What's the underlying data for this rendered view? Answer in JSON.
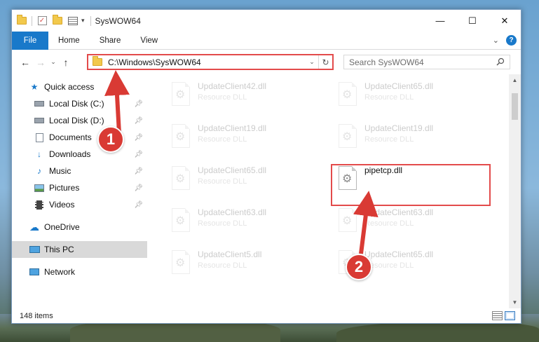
{
  "window": {
    "title": "SysWOW64"
  },
  "ribbon": {
    "tabs": [
      "File",
      "Home",
      "Share",
      "View"
    ]
  },
  "address": {
    "path": "C:\\Windows\\SysWOW64",
    "search_placeholder": "Search SysWOW64"
  },
  "nav": {
    "items": [
      {
        "label": "Quick access",
        "icon": "star-icon"
      },
      {
        "label": "Local Disk (C:)",
        "icon": "drive-icon"
      },
      {
        "label": "Local Disk (D:)",
        "icon": "drive-icon"
      },
      {
        "label": "Documents",
        "icon": "documents-icon"
      },
      {
        "label": "Downloads",
        "icon": "download-icon"
      },
      {
        "label": "Music",
        "icon": "music-icon"
      },
      {
        "label": "Pictures",
        "icon": "pictures-icon"
      },
      {
        "label": "Videos",
        "icon": "videos-icon"
      },
      {
        "label": "OneDrive",
        "icon": "cloud-icon"
      },
      {
        "label": "This PC",
        "icon": "computer-icon"
      },
      {
        "label": "Network",
        "icon": "network-icon"
      }
    ]
  },
  "files": [
    {
      "name": "UpdateClient42.dll",
      "desc": "Resource DLL"
    },
    {
      "name": "UpdateClient65.dll",
      "desc": "Resource DLL"
    },
    {
      "name": "UpdateClient19.dll",
      "desc": "Resource DLL"
    },
    {
      "name": "UpdateClient19.dll",
      "desc": "Resource DLL"
    },
    {
      "name": "UpdateClient65.dll",
      "desc": "Resource DLL"
    },
    {
      "name": "pipetcp.dll",
      "desc": ""
    },
    {
      "name": "UpdateClient63.dll",
      "desc": "Resource DLL"
    },
    {
      "name": "UpdateClient63.dll",
      "desc": "Resource DLL"
    },
    {
      "name": "UpdateClient5.dll",
      "desc": "Resource DLL"
    },
    {
      "name": "UpdateClient65.dll",
      "desc": "Resource DLL"
    }
  ],
  "status": {
    "item_count": "148 items"
  },
  "callouts": {
    "one": "1",
    "two": "2"
  },
  "colors": {
    "accent": "#1979ca",
    "highlight": "#e34b4b",
    "callout": "#d93a34"
  }
}
